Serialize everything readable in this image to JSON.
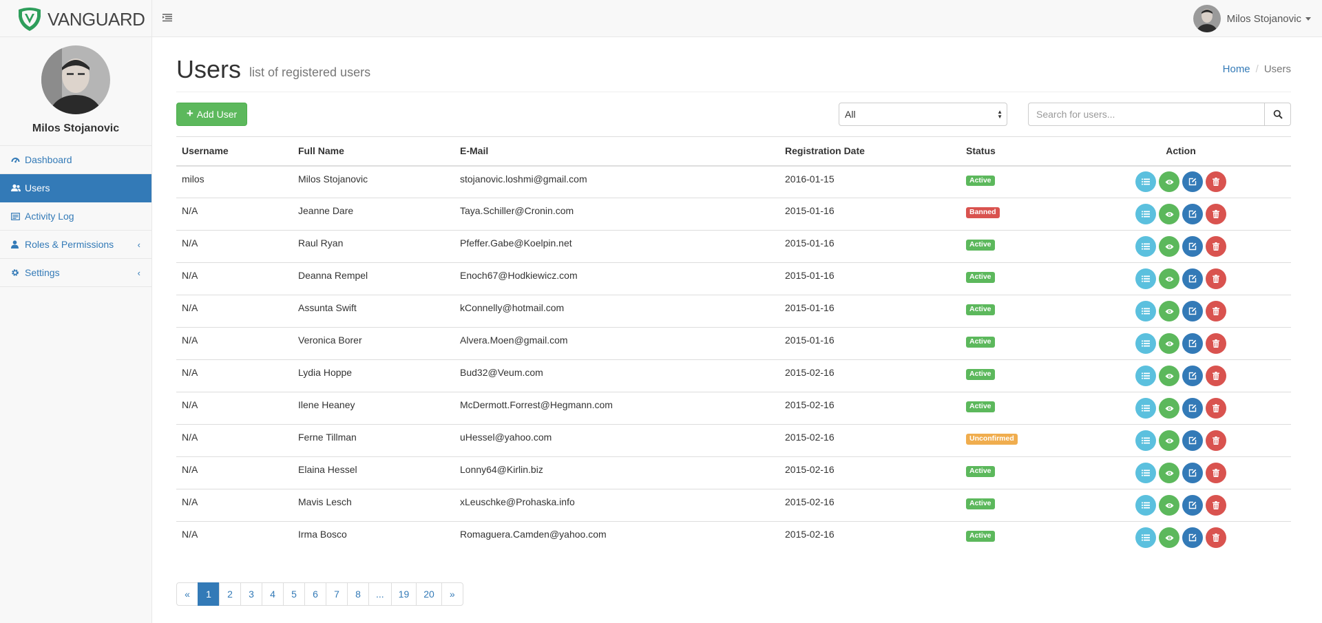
{
  "brand": {
    "name": "VANGUARD",
    "logo_color": "#2e9e5b"
  },
  "topbar": {
    "user_name": "Milos Stojanovic"
  },
  "sidebar": {
    "profile_name": "Milos Stojanovic",
    "items": [
      {
        "label": "Dashboard",
        "icon": "dashboard-icon"
      },
      {
        "label": "Users",
        "icon": "users-icon",
        "active": true
      },
      {
        "label": "Activity Log",
        "icon": "activity-log-icon"
      },
      {
        "label": "Roles & Permissions",
        "icon": "user-icon",
        "expandable": true
      },
      {
        "label": "Settings",
        "icon": "gear-icon",
        "expandable": true
      }
    ]
  },
  "page": {
    "title": "Users",
    "subtitle": "list of registered users"
  },
  "breadcrumb": {
    "home": "Home",
    "current": "Users"
  },
  "toolbar": {
    "add_label": "Add User",
    "filter_value": "All",
    "search_placeholder": "Search for users..."
  },
  "table": {
    "headers": [
      "Username",
      "Full Name",
      "E-Mail",
      "Registration Date",
      "Status",
      "Action"
    ],
    "rows": [
      {
        "username": "milos",
        "full_name": "Milos Stojanovic",
        "email": "stojanovic.loshmi@gmail.com",
        "date": "2016-01-15",
        "status": "Active"
      },
      {
        "username": "N/A",
        "full_name": "Jeanne Dare",
        "email": "Taya.Schiller@Cronin.com",
        "date": "2015-01-16",
        "status": "Banned"
      },
      {
        "username": "N/A",
        "full_name": "Raul Ryan",
        "email": "Pfeffer.Gabe@Koelpin.net",
        "date": "2015-01-16",
        "status": "Active"
      },
      {
        "username": "N/A",
        "full_name": "Deanna Rempel",
        "email": "Enoch67@Hodkiewicz.com",
        "date": "2015-01-16",
        "status": "Active"
      },
      {
        "username": "N/A",
        "full_name": "Assunta Swift",
        "email": "kConnelly@hotmail.com",
        "date": "2015-01-16",
        "status": "Active"
      },
      {
        "username": "N/A",
        "full_name": "Veronica Borer",
        "email": "Alvera.Moen@gmail.com",
        "date": "2015-01-16",
        "status": "Active"
      },
      {
        "username": "N/A",
        "full_name": "Lydia Hoppe",
        "email": "Bud32@Veum.com",
        "date": "2015-02-16",
        "status": "Active"
      },
      {
        "username": "N/A",
        "full_name": "Ilene Heaney",
        "email": "McDermott.Forrest@Hegmann.com",
        "date": "2015-02-16",
        "status": "Active"
      },
      {
        "username": "N/A",
        "full_name": "Ferne Tillman",
        "email": "uHessel@yahoo.com",
        "date": "2015-02-16",
        "status": "Unconfirmed"
      },
      {
        "username": "N/A",
        "full_name": "Elaina Hessel",
        "email": "Lonny64@Kirlin.biz",
        "date": "2015-02-16",
        "status": "Active"
      },
      {
        "username": "N/A",
        "full_name": "Mavis Lesch",
        "email": "xLeuschke@Prohaska.info",
        "date": "2015-02-16",
        "status": "Active"
      },
      {
        "username": "N/A",
        "full_name": "Irma Bosco",
        "email": "Romaguera.Camden@yahoo.com",
        "date": "2015-02-16",
        "status": "Active"
      }
    ],
    "status_styles": {
      "Active": "#5cb85c",
      "Banned": "#d9534f",
      "Unconfirmed": "#f0ad4e"
    },
    "row_actions": [
      "list-icon",
      "eye-icon",
      "edit-icon",
      "trash-icon"
    ]
  },
  "pagination": {
    "prev": "«",
    "pages": [
      "1",
      "2",
      "3",
      "4",
      "5",
      "6",
      "7",
      "8",
      "...",
      "19",
      "20"
    ],
    "current": "1",
    "next": "»"
  },
  "colors": {
    "primary": "#337ab7",
    "success": "#5cb85c",
    "danger": "#d9534f",
    "warning": "#f0ad4e",
    "info": "#5bc0de"
  }
}
